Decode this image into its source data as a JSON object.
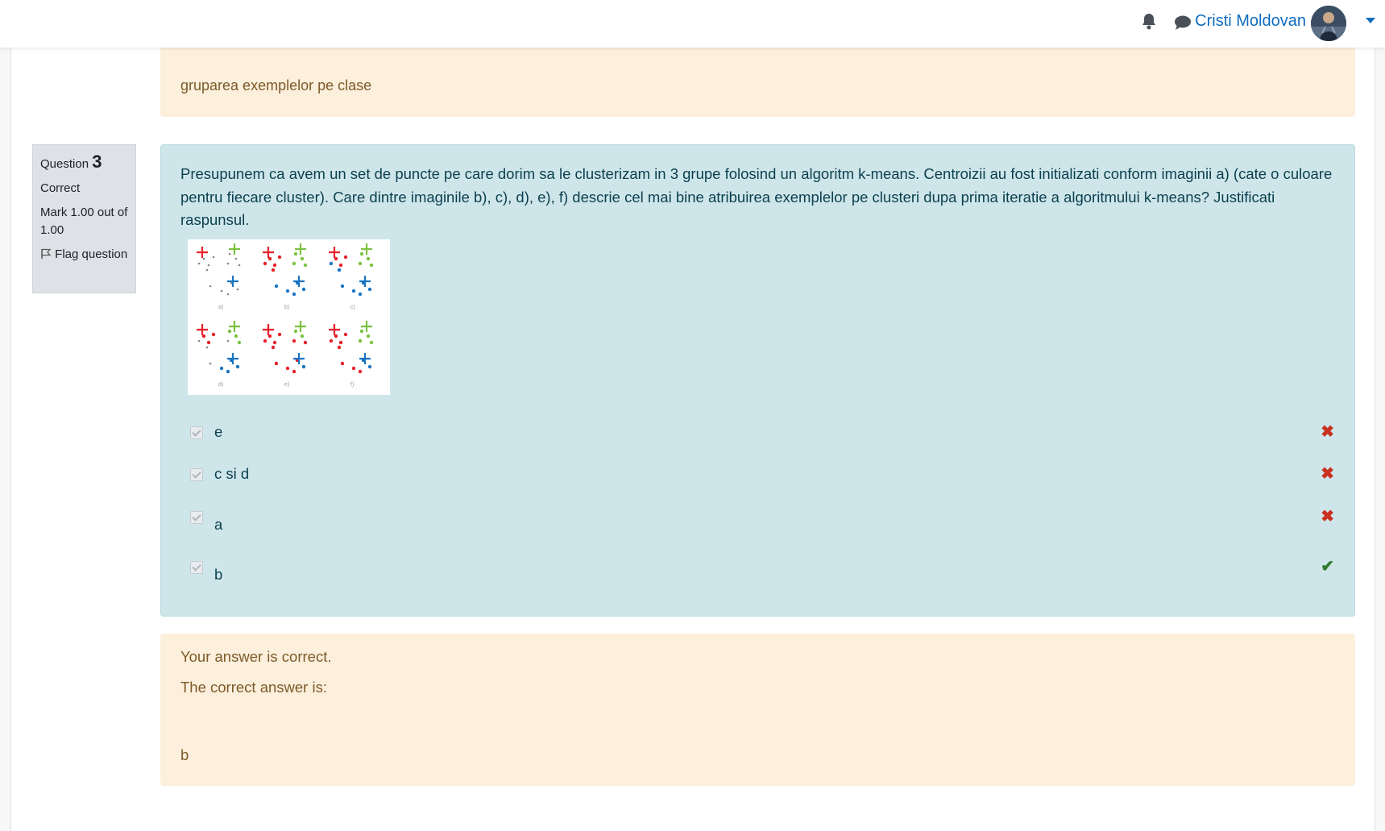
{
  "header": {
    "user_name": "Cristi Moldovan",
    "icons": {
      "notifications": "bell-icon",
      "messages": "chat-bubble-icon",
      "user_menu": "caret-down-icon"
    }
  },
  "previous_feedback": {
    "answer_text": "gruparea exemplelor pe clase"
  },
  "question_info": {
    "question_label": "Question",
    "question_number": "3",
    "state": "Correct",
    "mark": "Mark 1.00 out of 1.00",
    "flag_label": "Flag question"
  },
  "question": {
    "text": "Presupunem ca avem un set de puncte pe care dorim sa le clusterizam in 3 grupe folosind un algoritm k-means. Centroizii au fost initializati conform imaginii a) (cate o culoare pentru fiecare cluster). Care dintre imaginile b), c), d), e), f) descrie cel mai bine atribuirea exemplelor pe clusteri dupa prima iteratie a algoritmului k-means? Justificati raspunsul.",
    "image_panel_labels": [
      "a)",
      "b)",
      "c)",
      "d)",
      "e)",
      "f)"
    ],
    "colors": {
      "red": "#e8202a",
      "green": "#7cc242",
      "blue": "#1a75c2"
    },
    "answers": [
      {
        "label": "e",
        "checked": true,
        "result": "incorrect"
      },
      {
        "label": "c si d",
        "checked": true,
        "result": "incorrect"
      },
      {
        "label": "a",
        "checked": true,
        "result": "incorrect"
      },
      {
        "label": "b",
        "checked": true,
        "result": "correct"
      }
    ]
  },
  "outcome": {
    "status": "Your answer is correct.",
    "correct_answer_label": "The correct answer is:",
    "correct_answer": "b"
  },
  "theme": {
    "link_color": "#0f6cbf",
    "info_bg": "#cee6ea",
    "feedback_bg": "#fcefdc",
    "incorrect_color": "#ca3120",
    "correct_color": "#357a32"
  }
}
